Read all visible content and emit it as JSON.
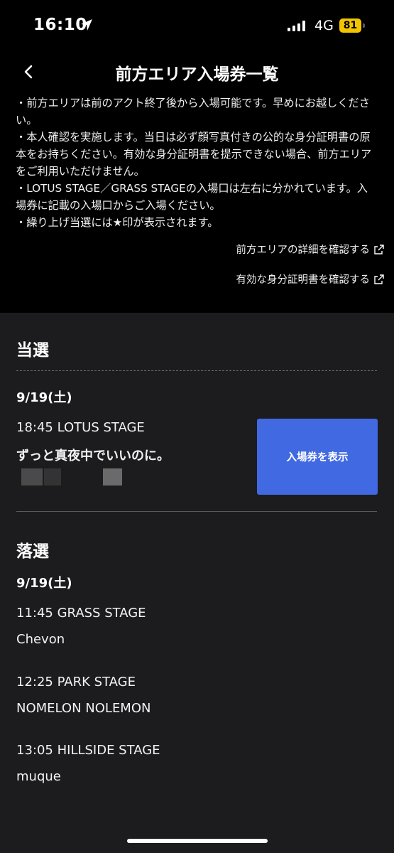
{
  "status_bar": {
    "time": "16:10",
    "network": "4G",
    "battery": "81"
  },
  "nav": {
    "title": "前方エリア入場券一覧"
  },
  "notes": [
    "・前方エリアは前のアクト終了後から入場可能です。早めにお越しください。",
    "・本人確認を実施します。当日は必ず顔写真付きの公的な身分証明書の原本をお持ちください。有効な身分証明書を提示できない場合、前方エリアをご利用いただけません。",
    "・LOTUS STAGE／GRASS STAGEの入場口は左右に分かれています。入場券に記載の入場口からご入場ください。",
    "・繰り上げ当選には★印が表示されます。"
  ],
  "links": {
    "details": "前方エリアの詳細を確認する",
    "id_docs": "有効な身分証明書を確認する"
  },
  "won": {
    "heading": "当選",
    "date": "9/19(土)",
    "entry": {
      "stage": "18:45 LOTUS STAGE",
      "artist": "ずっと真夜中でいいのに。"
    },
    "button_label": "入場券を表示"
  },
  "lost": {
    "heading": "落選",
    "date": "9/19(土)",
    "entries": [
      {
        "stage": "11:45 GRASS STAGE",
        "artist": "Chevon"
      },
      {
        "stage": "12:25 PARK STAGE",
        "artist": "NOMELON NOLEMON"
      },
      {
        "stage": "13:05 HILLSIDE STAGE",
        "artist": "muque"
      }
    ]
  }
}
